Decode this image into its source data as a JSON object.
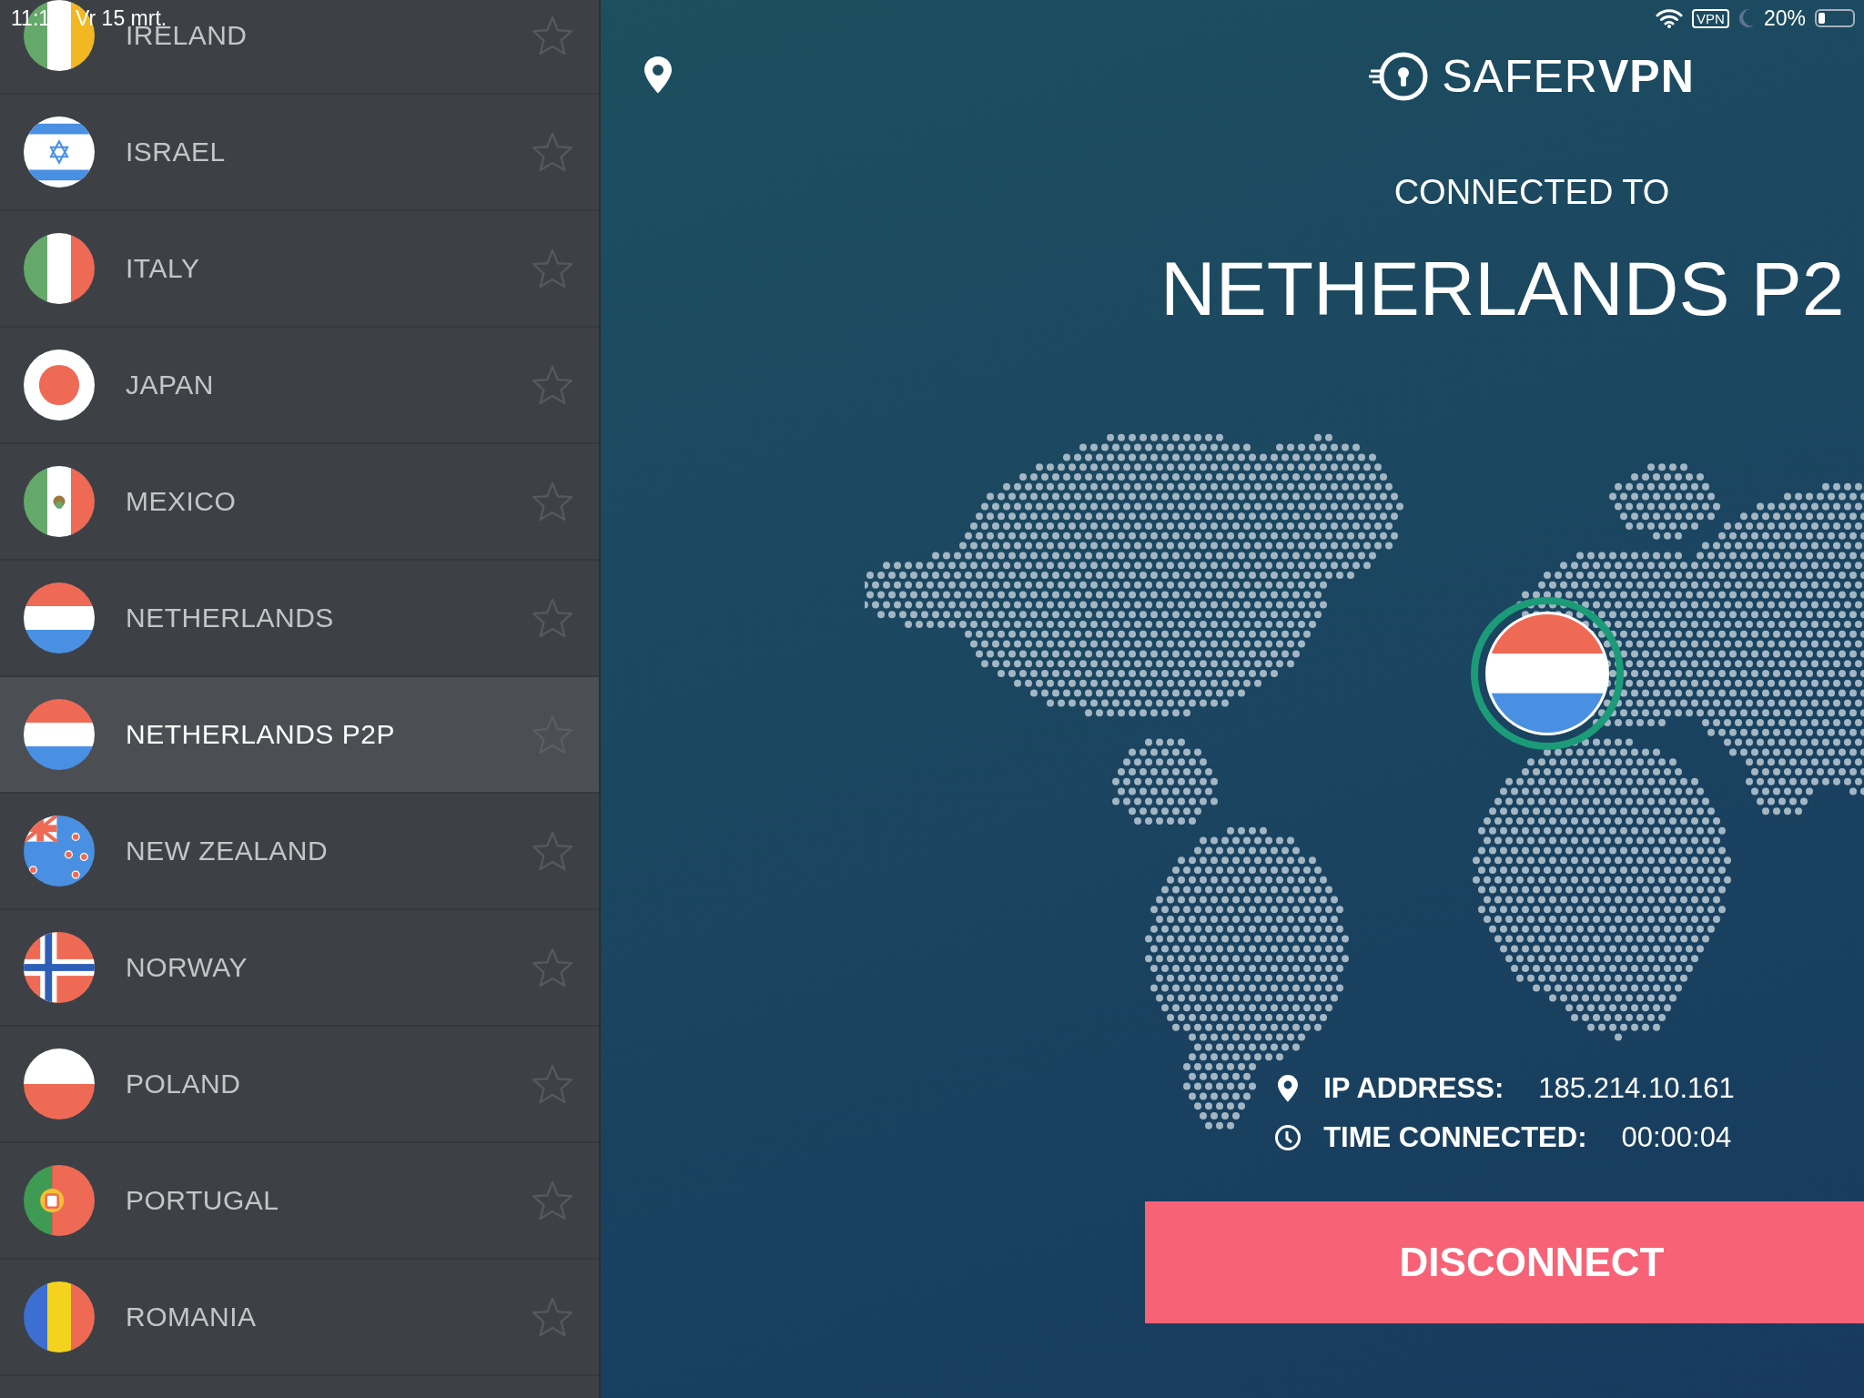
{
  "status_bar": {
    "time": "11:1",
    "date": "Vr 15 mrt.",
    "vpn": "VPN",
    "battery": "20%"
  },
  "countries": [
    {
      "name": "IRELAND",
      "kind": "ie",
      "selected": false,
      "favorite": false
    },
    {
      "name": "ISRAEL",
      "kind": "il",
      "selected": false,
      "favorite": false
    },
    {
      "name": "ITALY",
      "kind": "it",
      "selected": false,
      "favorite": false
    },
    {
      "name": "JAPAN",
      "kind": "jp",
      "selected": false,
      "favorite": false
    },
    {
      "name": "MEXICO",
      "kind": "mx",
      "selected": false,
      "favorite": false
    },
    {
      "name": "NETHERLANDS",
      "kind": "nl",
      "selected": false,
      "favorite": false
    },
    {
      "name": "NETHERLANDS P2P",
      "kind": "nl",
      "selected": true,
      "favorite": false
    },
    {
      "name": "NEW ZEALAND",
      "kind": "nz",
      "selected": false,
      "favorite": false
    },
    {
      "name": "NORWAY",
      "kind": "no",
      "selected": false,
      "favorite": false
    },
    {
      "name": "POLAND",
      "kind": "pl",
      "selected": false,
      "favorite": false
    },
    {
      "name": "PORTUGAL",
      "kind": "pt",
      "selected": false,
      "favorite": false
    },
    {
      "name": "ROMANIA",
      "kind": "ro",
      "selected": false,
      "favorite": false
    }
  ],
  "main": {
    "brand": "SAFER**VPN**",
    "heading": "CONNECTED TO",
    "server": "NETHERLANDS P2",
    "info": [
      {
        "kind": "ip",
        "label": "IP ADDRESS:",
        "value": "185.214.10.161"
      },
      {
        "kind": "time",
        "label": "TIME CONNECTED:",
        "value": "00:00:04"
      }
    ],
    "button": "DISCONNECT"
  }
}
